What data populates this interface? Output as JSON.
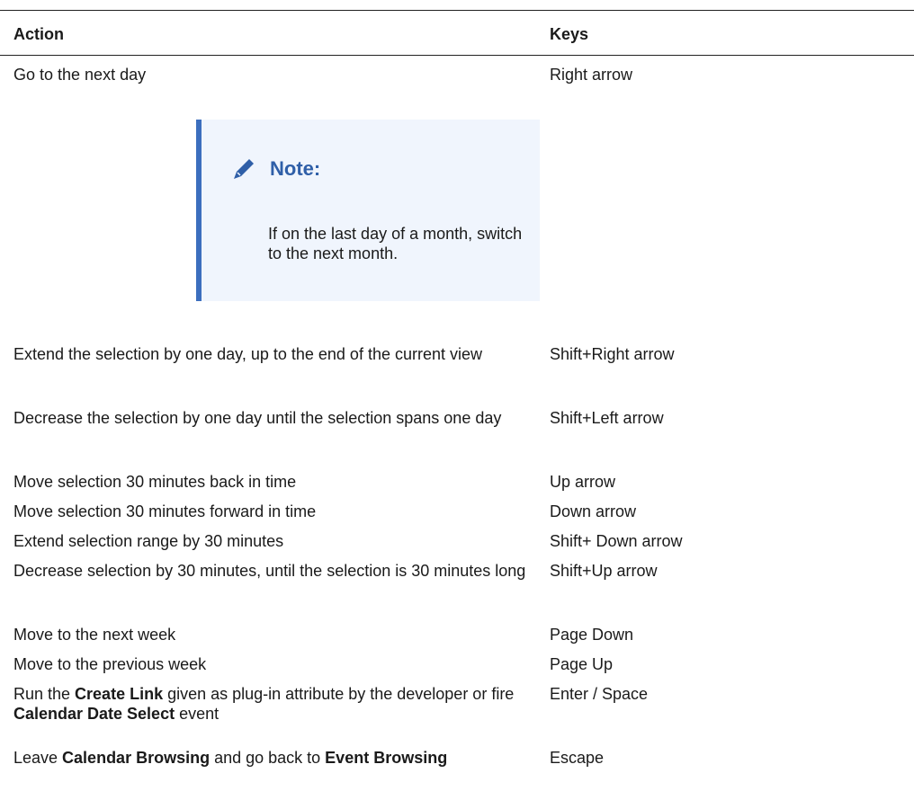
{
  "table": {
    "headers": {
      "action": "Action",
      "keys": "Keys"
    },
    "rows": [
      {
        "action": "Go to the next day",
        "keys": "Right arrow"
      },
      {
        "action": "Extend the selection by one day, up to the end of the current view",
        "keys": "Shift+Right arrow"
      },
      {
        "action": "Decrease the selection by one day until the selection spans one day",
        "keys": "Shift+Left arrow"
      },
      {
        "action": "Move selection 30 minutes back in time",
        "keys": "Up arrow"
      },
      {
        "action": "Move selection 30 minutes forward in time",
        "keys": "Down arrow"
      },
      {
        "action": "Extend selection range by 30 minutes",
        "keys": "Shift+ Down arrow"
      },
      {
        "action": "Decrease selection by 30 minutes, until the selection is 30 minutes long",
        "keys": "Shift+Up arrow"
      },
      {
        "action": "Move to the next week",
        "keys": "Page Down"
      },
      {
        "action": "Move to the previous week",
        "keys": "Page Up"
      },
      {
        "action_parts": [
          "Run the ",
          "Create Link",
          " given as plug-in attribute by the developer or fire ",
          "Calendar Date Select",
          " event"
        ],
        "keys": "Enter / Space"
      },
      {
        "action_parts": [
          "Leave ",
          "Calendar Browsing",
          " and go back to ",
          "Event Browsing"
        ],
        "keys": "Escape"
      }
    ]
  },
  "note": {
    "title": "Note:",
    "body": "If on the last day of a month, switch to the next month.",
    "icon": "pencil-icon",
    "accent_color": "#3c6ebe",
    "background_color": "#f0f5fd"
  }
}
